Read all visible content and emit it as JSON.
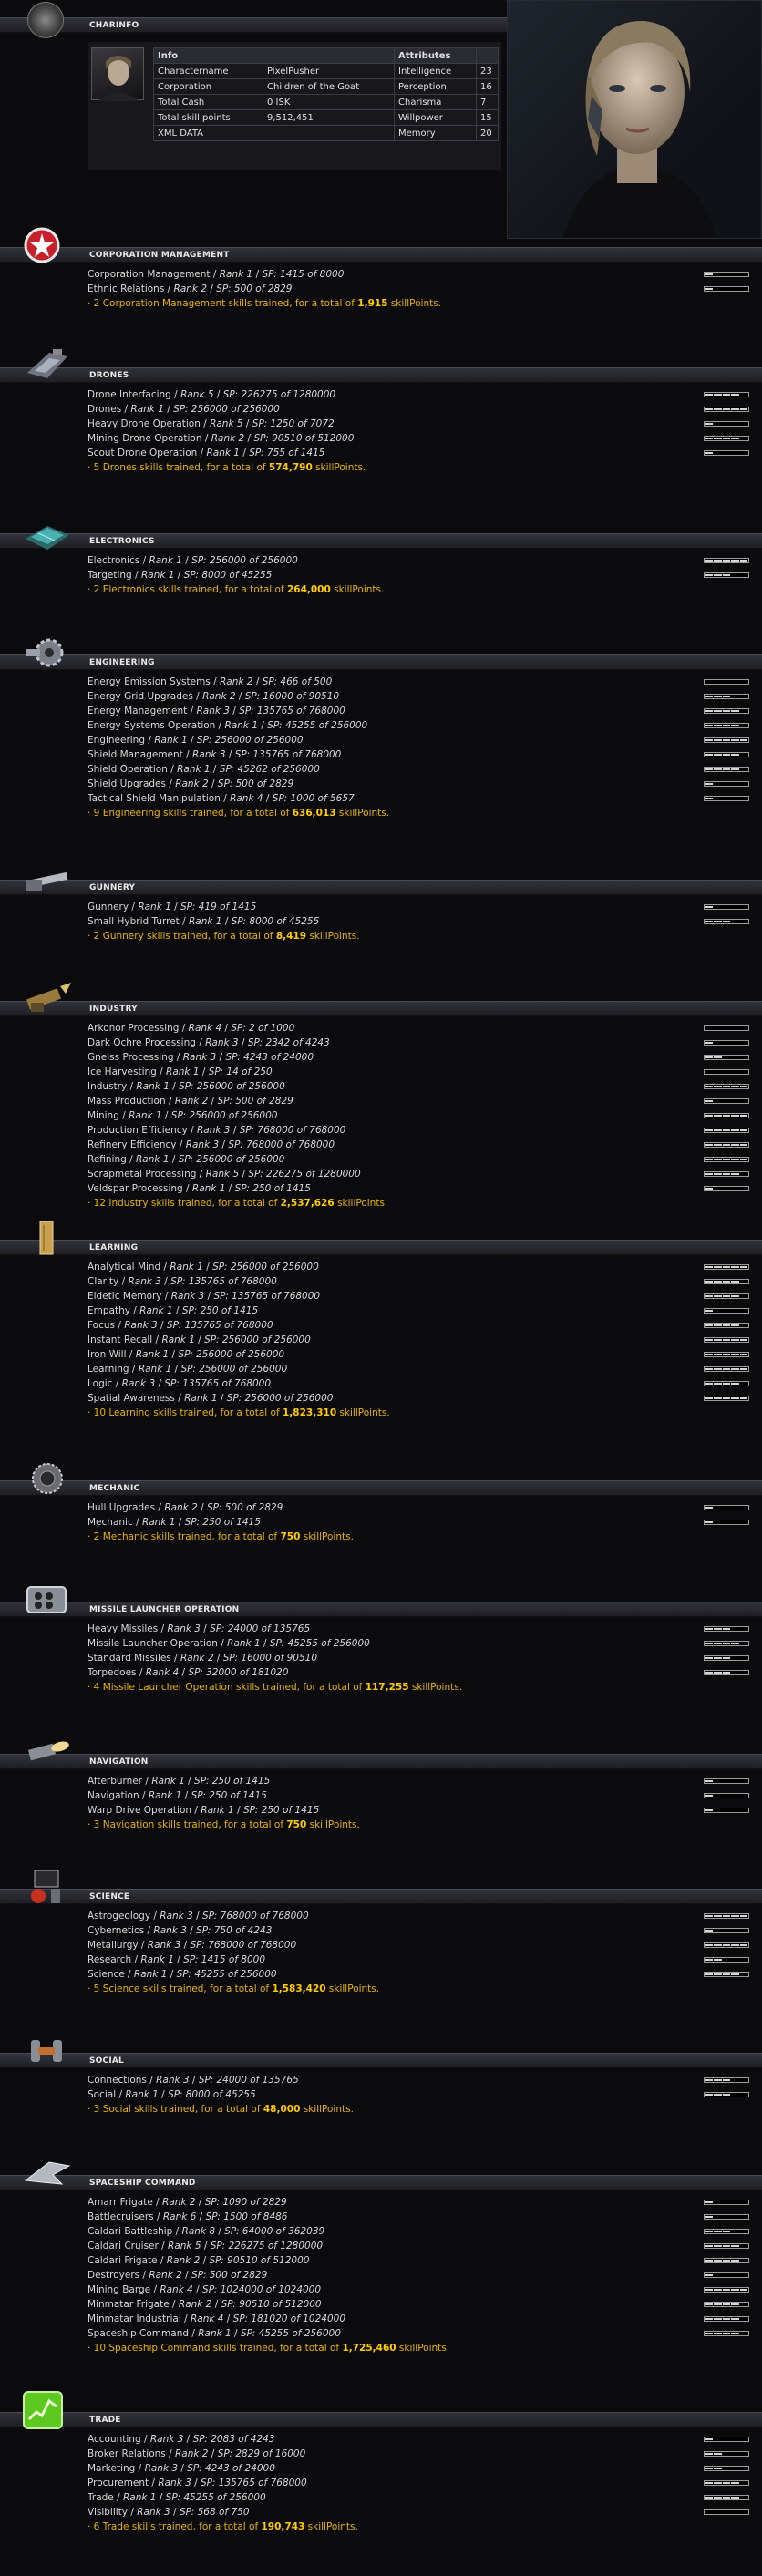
{
  "charinfo": {
    "header": "CHARINFO",
    "info_header": "Info",
    "attributes_header": "Attributes",
    "rows": [
      {
        "label": "Charactername",
        "value": "PixelPusher",
        "attr": "Intelligence",
        "attr_value": "23"
      },
      {
        "label": "Corporation",
        "value": "Children of the Goat",
        "attr": "Perception",
        "attr_value": "16"
      },
      {
        "label": "Total Cash",
        "value": "0 ISK",
        "attr": "Charisma",
        "attr_value": "7"
      },
      {
        "label": "Total skill points",
        "value": "9,512,451",
        "attr": "Willpower",
        "attr_value": "15"
      },
      {
        "label": "XML DATA",
        "value": "",
        "attr": "Memory",
        "attr_value": "20"
      }
    ]
  },
  "groups": [
    {
      "title": "CORPORATION MANAGEMENT",
      "icon": "corporation-star-icon",
      "skills": [
        {
          "name": "Corporation Management",
          "rank": "Rank 1",
          "sp": "SP: 1415 of 8000",
          "level": 1
        },
        {
          "name": "Ethnic Relations",
          "rank": "Rank 2",
          "sp": "SP: 500 of 2829",
          "level": 1
        }
      ],
      "summary_pre": "· 2 Corporation Management skills trained, for a total of ",
      "total": "1,915",
      "summary_post": " skillPoints."
    },
    {
      "title": "DRONES",
      "icon": "drones-icon",
      "skills": [
        {
          "name": "Drone Interfacing",
          "rank": "Rank 5",
          "sp": "SP: 226275 of 1280000",
          "level": 4
        },
        {
          "name": "Drones",
          "rank": "Rank 1",
          "sp": "SP: 256000 of 256000",
          "level": 5
        },
        {
          "name": "Heavy Drone Operation",
          "rank": "Rank 5",
          "sp": "SP: 1250 of 7072",
          "level": 1
        },
        {
          "name": "Mining Drone Operation",
          "rank": "Rank 2",
          "sp": "SP: 90510 of 512000",
          "level": 4
        },
        {
          "name": "Scout Drone Operation",
          "rank": "Rank 1",
          "sp": "SP: 755 of 1415",
          "level": 1
        }
      ],
      "summary_pre": "· 5 Drones skills trained, for a total of ",
      "total": "574,790",
      "summary_post": " skillPoints."
    },
    {
      "title": "ELECTRONICS",
      "icon": "electronics-chip-icon",
      "skills": [
        {
          "name": "Electronics",
          "rank": "Rank 1",
          "sp": "SP: 256000 of 256000",
          "level": 5
        },
        {
          "name": "Targeting",
          "rank": "Rank 1",
          "sp": "SP: 8000 of 45255",
          "level": 3
        }
      ],
      "summary_pre": "· 2 Electronics skills trained, for a total of ",
      "total": "264,000",
      "summary_post": " skillPoints."
    },
    {
      "title": "ENGINEERING",
      "icon": "engineering-gear-icon",
      "skills": [
        {
          "name": "Energy Emission Systems",
          "rank": "Rank 2",
          "sp": "SP: 466 of 500",
          "level": 0
        },
        {
          "name": "Energy Grid Upgrades",
          "rank": "Rank 2",
          "sp": "SP: 16000 of 90510",
          "level": 3
        },
        {
          "name": "Energy Management",
          "rank": "Rank 3",
          "sp": "SP: 135765 of 768000",
          "level": 4
        },
        {
          "name": "Energy Systems Operation",
          "rank": "Rank 1",
          "sp": "SP: 45255 of 256000",
          "level": 4
        },
        {
          "name": "Engineering",
          "rank": "Rank 1",
          "sp": "SP: 256000 of 256000",
          "level": 5
        },
        {
          "name": "Shield Management",
          "rank": "Rank 3",
          "sp": "SP: 135765 of 768000",
          "level": 4
        },
        {
          "name": "Shield Operation",
          "rank": "Rank 1",
          "sp": "SP: 45262 of 256000",
          "level": 4
        },
        {
          "name": "Shield Upgrades",
          "rank": "Rank 2",
          "sp": "SP: 500 of 2829",
          "level": 1
        },
        {
          "name": "Tactical Shield Manipulation",
          "rank": "Rank 4",
          "sp": "SP: 1000 of 5657",
          "level": 1
        }
      ],
      "summary_pre": "· 9 Engineering skills trained, for a total of ",
      "total": "636,013",
      "summary_post": " skillPoints."
    },
    {
      "title": "GUNNERY",
      "icon": "gunnery-turret-icon",
      "skills": [
        {
          "name": "Gunnery",
          "rank": "Rank 1",
          "sp": "SP: 419 of 1415",
          "level": 1
        },
        {
          "name": "Small Hybrid Turret",
          "rank": "Rank 1",
          "sp": "SP: 8000 of 45255",
          "level": 3
        }
      ],
      "summary_pre": "· 2 Gunnery skills trained, for a total of ",
      "total": "8,419",
      "summary_post": " skillPoints."
    },
    {
      "title": "INDUSTRY",
      "icon": "industry-drill-icon",
      "skills": [
        {
          "name": "Arkonor Processing",
          "rank": "Rank 4",
          "sp": "SP: 2 of 1000",
          "level": 0
        },
        {
          "name": "Dark Ochre Processing",
          "rank": "Rank 3",
          "sp": "SP: 2342 of 4243",
          "level": 1
        },
        {
          "name": "Gneiss Processing",
          "rank": "Rank 3",
          "sp": "SP: 4243 of 24000",
          "level": 2
        },
        {
          "name": "Ice Harvesting",
          "rank": "Rank 1",
          "sp": "SP: 14 of 250",
          "level": 0
        },
        {
          "name": "Industry",
          "rank": "Rank 1",
          "sp": "SP: 256000 of 256000",
          "level": 5
        },
        {
          "name": "Mass Production",
          "rank": "Rank 2",
          "sp": "SP: 500 of 2829",
          "level": 1
        },
        {
          "name": "Mining",
          "rank": "Rank 1",
          "sp": "SP: 256000 of 256000",
          "level": 5
        },
        {
          "name": "Production Efficiency",
          "rank": "Rank 3",
          "sp": "SP: 768000 of 768000",
          "level": 5
        },
        {
          "name": "Refinery Efficiency",
          "rank": "Rank 3",
          "sp": "SP: 768000 of 768000",
          "level": 5
        },
        {
          "name": "Refining",
          "rank": "Rank 1",
          "sp": "SP: 256000 of 256000",
          "level": 5
        },
        {
          "name": "Scrapmetal Processing",
          "rank": "Rank 5",
          "sp": "SP: 226275 of 1280000",
          "level": 4
        },
        {
          "name": "Veldspar Processing",
          "rank": "Rank 1",
          "sp": "SP: 250 of 1415",
          "level": 1
        }
      ],
      "summary_pre": "· 12 Industry skills trained, for a total of ",
      "total": "2,537,626",
      "summary_post": " skillPoints."
    },
    {
      "title": "LEARNING",
      "icon": "learning-book-icon",
      "skills": [
        {
          "name": "Analytical Mind",
          "rank": "Rank 1",
          "sp": "SP: 256000 of 256000",
          "level": 5
        },
        {
          "name": "Clarity",
          "rank": "Rank 3",
          "sp": "SP: 135765 of 768000",
          "level": 4
        },
        {
          "name": "Eidetic Memory",
          "rank": "Rank 3",
          "sp": "SP: 135765 of 768000",
          "level": 4
        },
        {
          "name": "Empathy",
          "rank": "Rank 1",
          "sp": "SP: 250 of 1415",
          "level": 1
        },
        {
          "name": "Focus",
          "rank": "Rank 3",
          "sp": "SP: 135765 of 768000",
          "level": 4
        },
        {
          "name": "Instant Recall",
          "rank": "Rank 1",
          "sp": "SP: 256000 of 256000",
          "level": 5
        },
        {
          "name": "Iron Will",
          "rank": "Rank 1",
          "sp": "SP: 256000 of 256000",
          "level": 5
        },
        {
          "name": "Learning",
          "rank": "Rank 1",
          "sp": "SP: 256000 of 256000",
          "level": 5
        },
        {
          "name": "Logic",
          "rank": "Rank 3",
          "sp": "SP: 135765 of 768000",
          "level": 4
        },
        {
          "name": "Spatial Awareness",
          "rank": "Rank 1",
          "sp": "SP: 256000 of 256000",
          "level": 5
        }
      ],
      "summary_pre": "· 10 Learning skills trained, for a total of ",
      "total": "1,823,310",
      "summary_post": " skillPoints."
    },
    {
      "title": "MECHANIC",
      "icon": "mechanic-saw-icon",
      "skills": [
        {
          "name": "Hull Upgrades",
          "rank": "Rank 2",
          "sp": "SP: 500 of 2829",
          "level": 1
        },
        {
          "name": "Mechanic",
          "rank": "Rank 1",
          "sp": "SP: 250 of 1415",
          "level": 1
        }
      ],
      "summary_pre": "· 2 Mechanic skills trained, for a total of ",
      "total": "750",
      "summary_post": " skillPoints."
    },
    {
      "title": "MISSILE LAUNCHER OPERATION",
      "icon": "missile-launcher-icon",
      "skills": [
        {
          "name": "Heavy Missiles",
          "rank": "Rank 3",
          "sp": "SP: 24000 of 135765",
          "level": 3
        },
        {
          "name": "Missile Launcher Operation",
          "rank": "Rank 1",
          "sp": "SP: 45255 of 256000",
          "level": 4
        },
        {
          "name": "Standard Missiles",
          "rank": "Rank 2",
          "sp": "SP: 16000 of 90510",
          "level": 3
        },
        {
          "name": "Torpedoes",
          "rank": "Rank 4",
          "sp": "SP: 32000 of 181020",
          "level": 3
        }
      ],
      "summary_pre": "· 4 Missile Launcher Operation skills trained, for a total of ",
      "total": "117,255",
      "summary_post": " skillPoints."
    },
    {
      "title": "NAVIGATION",
      "icon": "navigation-thruster-icon",
      "skills": [
        {
          "name": "Afterburner",
          "rank": "Rank 1",
          "sp": "SP: 250 of 1415",
          "level": 1
        },
        {
          "name": "Navigation",
          "rank": "Rank 1",
          "sp": "SP: 250 of 1415",
          "level": 1
        },
        {
          "name": "Warp Drive Operation",
          "rank": "Rank 1",
          "sp": "SP: 250 of 1415",
          "level": 1
        }
      ],
      "summary_pre": "· 3 Navigation skills trained, for a total of ",
      "total": "750",
      "summary_post": " skillPoints."
    },
    {
      "title": "SCIENCE",
      "icon": "science-flask-icon",
      "skills": [
        {
          "name": "Astrogeology",
          "rank": "Rank 3",
          "sp": "SP: 768000 of 768000",
          "level": 5
        },
        {
          "name": "Cybernetics",
          "rank": "Rank 3",
          "sp": "SP: 750 of 4243",
          "level": 1
        },
        {
          "name": "Metallurgy",
          "rank": "Rank 3",
          "sp": "SP: 768000 of 768000",
          "level": 5
        },
        {
          "name": "Research",
          "rank": "Rank 1",
          "sp": "SP: 1415 of 8000",
          "level": 2
        },
        {
          "name": "Science",
          "rank": "Rank 1",
          "sp": "SP: 45255 of 256000",
          "level": 4
        }
      ],
      "summary_pre": "· 5 Science skills trained, for a total of ",
      "total": "1,583,420",
      "summary_post": " skillPoints."
    },
    {
      "title": "SOCIAL",
      "icon": "social-handshake-icon",
      "skills": [
        {
          "name": "Connections",
          "rank": "Rank 3",
          "sp": "SP: 24000 of 135765",
          "level": 3
        },
        {
          "name": "Social",
          "rank": "Rank 1",
          "sp": "SP: 8000 of 45255",
          "level": 3
        }
      ],
      "summary_pre": "· 3 Social skills trained, for a total of ",
      "total": "48,000",
      "summary_post": " skillPoints."
    },
    {
      "title": "SPACESHIP COMMAND",
      "icon": "spaceship-icon",
      "skills": [
        {
          "name": "Amarr Frigate",
          "rank": "Rank 2",
          "sp": "SP: 1090 of 2829",
          "level": 1
        },
        {
          "name": "Battlecruisers",
          "rank": "Rank 6",
          "sp": "SP: 1500 of 8486",
          "level": 1
        },
        {
          "name": "Caldari Battleship",
          "rank": "Rank 8",
          "sp": "SP: 64000 of 362039",
          "level": 3
        },
        {
          "name": "Caldari Cruiser",
          "rank": "Rank 5",
          "sp": "SP: 226275 of 1280000",
          "level": 4
        },
        {
          "name": "Caldari Frigate",
          "rank": "Rank 2",
          "sp": "SP: 90510 of 512000",
          "level": 4
        },
        {
          "name": "Destroyers",
          "rank": "Rank 2",
          "sp": "SP: 500 of 2829",
          "level": 1
        },
        {
          "name": "Mining Barge",
          "rank": "Rank 4",
          "sp": "SP: 1024000 of 1024000",
          "level": 5
        },
        {
          "name": "Minmatar Frigate",
          "rank": "Rank 2",
          "sp": "SP: 90510 of 512000",
          "level": 4
        },
        {
          "name": "Minmatar Industrial",
          "rank": "Rank 4",
          "sp": "SP: 181020 of 1024000",
          "level": 4
        },
        {
          "name": "Spaceship Command",
          "rank": "Rank 1",
          "sp": "SP: 45255 of 256000",
          "level": 4
        }
      ],
      "summary_pre": "· 10 Spaceship Command skills trained, for a total of ",
      "total": "1,725,460",
      "summary_post": " skillPoints."
    },
    {
      "title": "TRADE",
      "icon": "trade-chart-icon",
      "skills": [
        {
          "name": "Accounting",
          "rank": "Rank 3",
          "sp": "SP: 2083 of 4243",
          "level": 1
        },
        {
          "name": "Broker Relations",
          "rank": "Rank 2",
          "sp": "SP: 2829 of 16000",
          "level": 2
        },
        {
          "name": "Marketing",
          "rank": "Rank 3",
          "sp": "SP: 4243 of 24000",
          "level": 2
        },
        {
          "name": "Procurement",
          "rank": "Rank 3",
          "sp": "SP: 135765 of 768000",
          "level": 4
        },
        {
          "name": "Trade",
          "rank": "Rank 1",
          "sp": "SP: 45255 of 256000",
          "level": 4
        },
        {
          "name": "Visibility",
          "rank": "Rank 3",
          "sp": "SP: 568 of 750",
          "level": 0
        }
      ],
      "summary_pre": "· 6 Trade skills trained, for a total of ",
      "total": "190,743",
      "summary_post": " skillPoints."
    }
  ]
}
